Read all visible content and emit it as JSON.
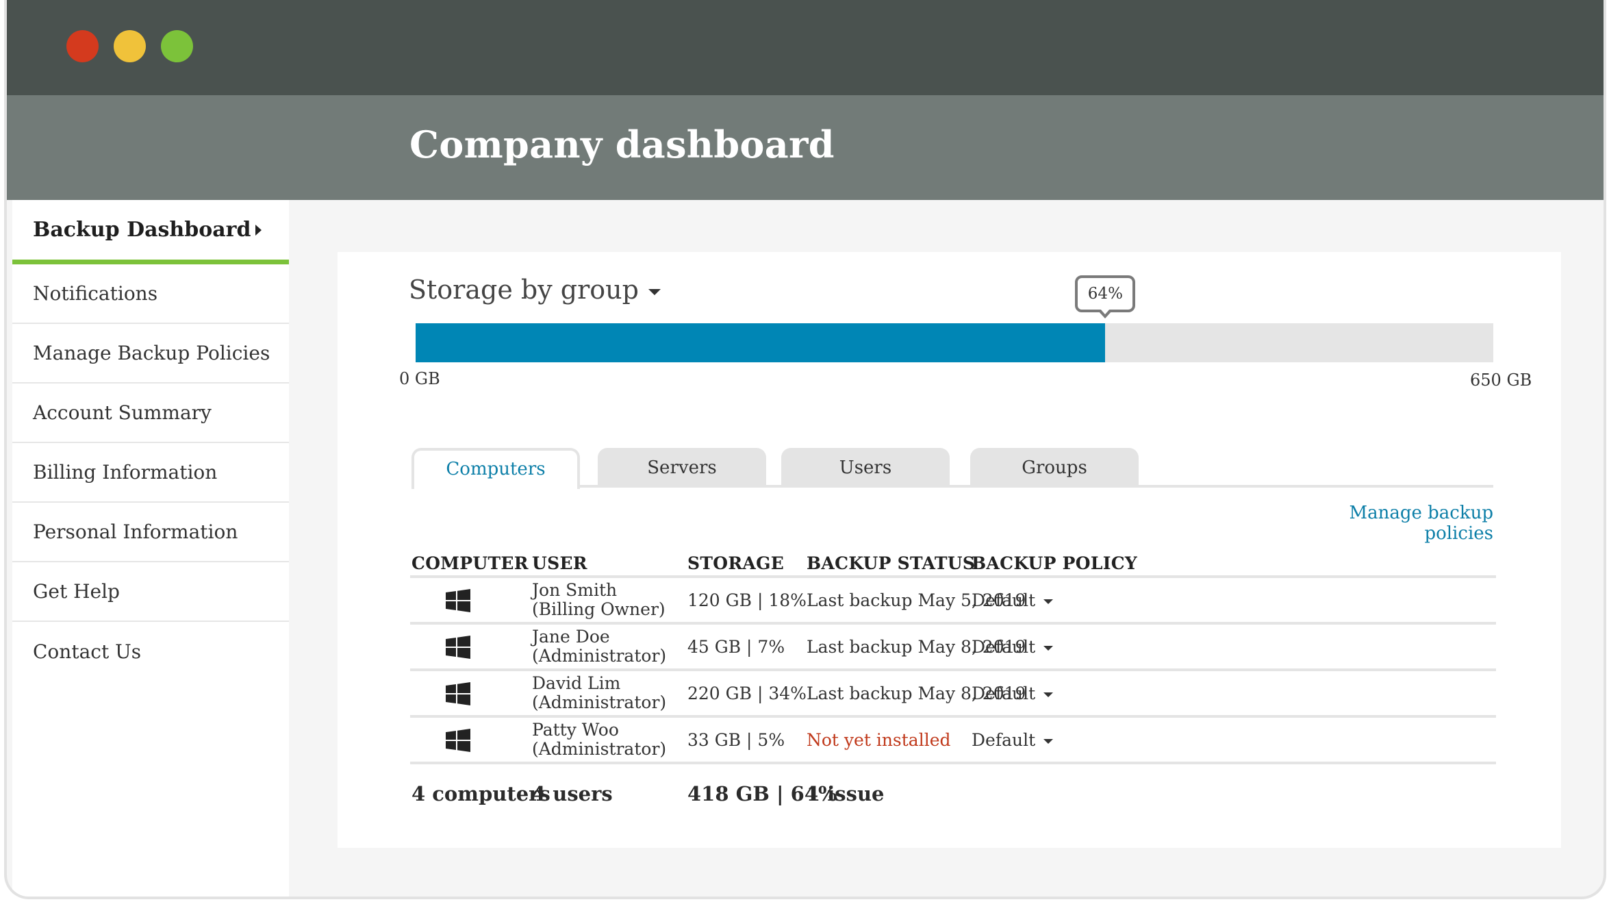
{
  "window": {
    "controls": [
      {
        "name": "close-button",
        "color": "#d43a1e"
      },
      {
        "name": "minimize-button",
        "color": "#f0c23a"
      },
      {
        "name": "maximize-button",
        "color": "#7cc23a"
      }
    ]
  },
  "header": {
    "title": "Company dashboard"
  },
  "sidebar": {
    "items": [
      {
        "label": "Backup Dashboard",
        "active": true,
        "icon": "chevron-right-icon"
      },
      {
        "label": "Notifications"
      },
      {
        "label": "Manage Backup Policies"
      },
      {
        "label": "Account Summary"
      },
      {
        "label": "Billing Information"
      },
      {
        "label": "Personal Information"
      },
      {
        "label": "Get Help"
      },
      {
        "label": "Contact Us"
      }
    ]
  },
  "storage": {
    "title": "Storage by group",
    "title_icon": "caret-down-icon",
    "percent_label": "64%",
    "percent_value": 0.64,
    "min_label": "0 GB",
    "max_label": "650 GB",
    "fill_color": "#0086b5"
  },
  "tabs": [
    {
      "label": "Computers",
      "active": true
    },
    {
      "label": "Servers"
    },
    {
      "label": "Users"
    },
    {
      "label": "Groups"
    }
  ],
  "manage_link": "Manage backup policies",
  "table": {
    "headers": [
      "COMPUTER",
      "USER",
      "STORAGE",
      "BACKUP STATUS",
      "BACKUP POLICY"
    ],
    "rows": [
      {
        "os_icon": "windows-icon",
        "user_name": "Jon Smith",
        "user_role": "(Billing Owner)",
        "storage": "120 GB | 18%",
        "status": "Last backup May 5, 2019",
        "status_warn": false,
        "policy": "Default"
      },
      {
        "os_icon": "windows-icon",
        "user_name": "Jane Doe",
        "user_role": "(Administrator)",
        "storage": "45 GB | 7%",
        "status": "Last backup May 8, 2019",
        "status_warn": false,
        "policy": "Default"
      },
      {
        "os_icon": "windows-icon",
        "user_name": "David Lim",
        "user_role": "(Administrator)",
        "storage": "220 GB | 34%",
        "status": "Last backup May 8, 2019",
        "status_warn": false,
        "policy": "Default"
      },
      {
        "os_icon": "windows-icon",
        "user_name": "Patty Woo",
        "user_role": "(Administrator)",
        "storage": "33 GB | 5%",
        "status": "Not yet installed",
        "status_warn": true,
        "policy": "Default"
      }
    ],
    "footer": {
      "computers": "4 computers",
      "users": "4 users",
      "storage": "418 GB | 64%",
      "issues": "1 issue"
    },
    "warn_color": "#c0391b"
  }
}
